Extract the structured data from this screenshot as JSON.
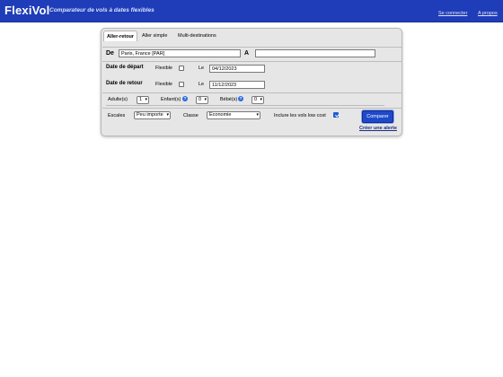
{
  "header": {
    "logo": "FlexiVol",
    "tagline": "Comparateur de vols à dates flexibles",
    "login_link": "Se connecter",
    "about_link": "A propos"
  },
  "tabs": [
    {
      "label": "Aller-retour",
      "active": true
    },
    {
      "label": "Aller simple",
      "active": false
    },
    {
      "label": "Multi-destinations",
      "active": false
    }
  ],
  "route": {
    "from_label": "De",
    "from_value": "Paris, France [PAR]",
    "to_label": "A",
    "to_value": ""
  },
  "departure": {
    "label": "Date de départ",
    "flexible_label": "Flexible",
    "flexible_checked": false,
    "date_label": "Le",
    "date_value": "04/12/2023"
  },
  "return": {
    "label": "Date de retour",
    "flexible_label": "Flexible",
    "flexible_checked": false,
    "date_label": "Le",
    "date_value": "11/12/2023"
  },
  "passengers": {
    "adults_label": "Adulte(s)",
    "adults_value": "1",
    "children_label": "Enfant(s)",
    "children_value": "0",
    "babies_label": "Bébé(s)",
    "babies_value": "0",
    "help_glyph": "?"
  },
  "options": {
    "stops_label": "Escales",
    "stops_value": "Peu importe",
    "class_label": "Classe",
    "class_value": "Economie",
    "lowcost_label": "Inclure les vols low cost",
    "lowcost_checked": true,
    "compare_button": "Comparer",
    "alert_link": "Créer une alerte"
  },
  "colors": {
    "header_bg": "#1f3db8",
    "button_bg": "#1f49c9",
    "checkbox_accent": "#1f5bd4"
  }
}
